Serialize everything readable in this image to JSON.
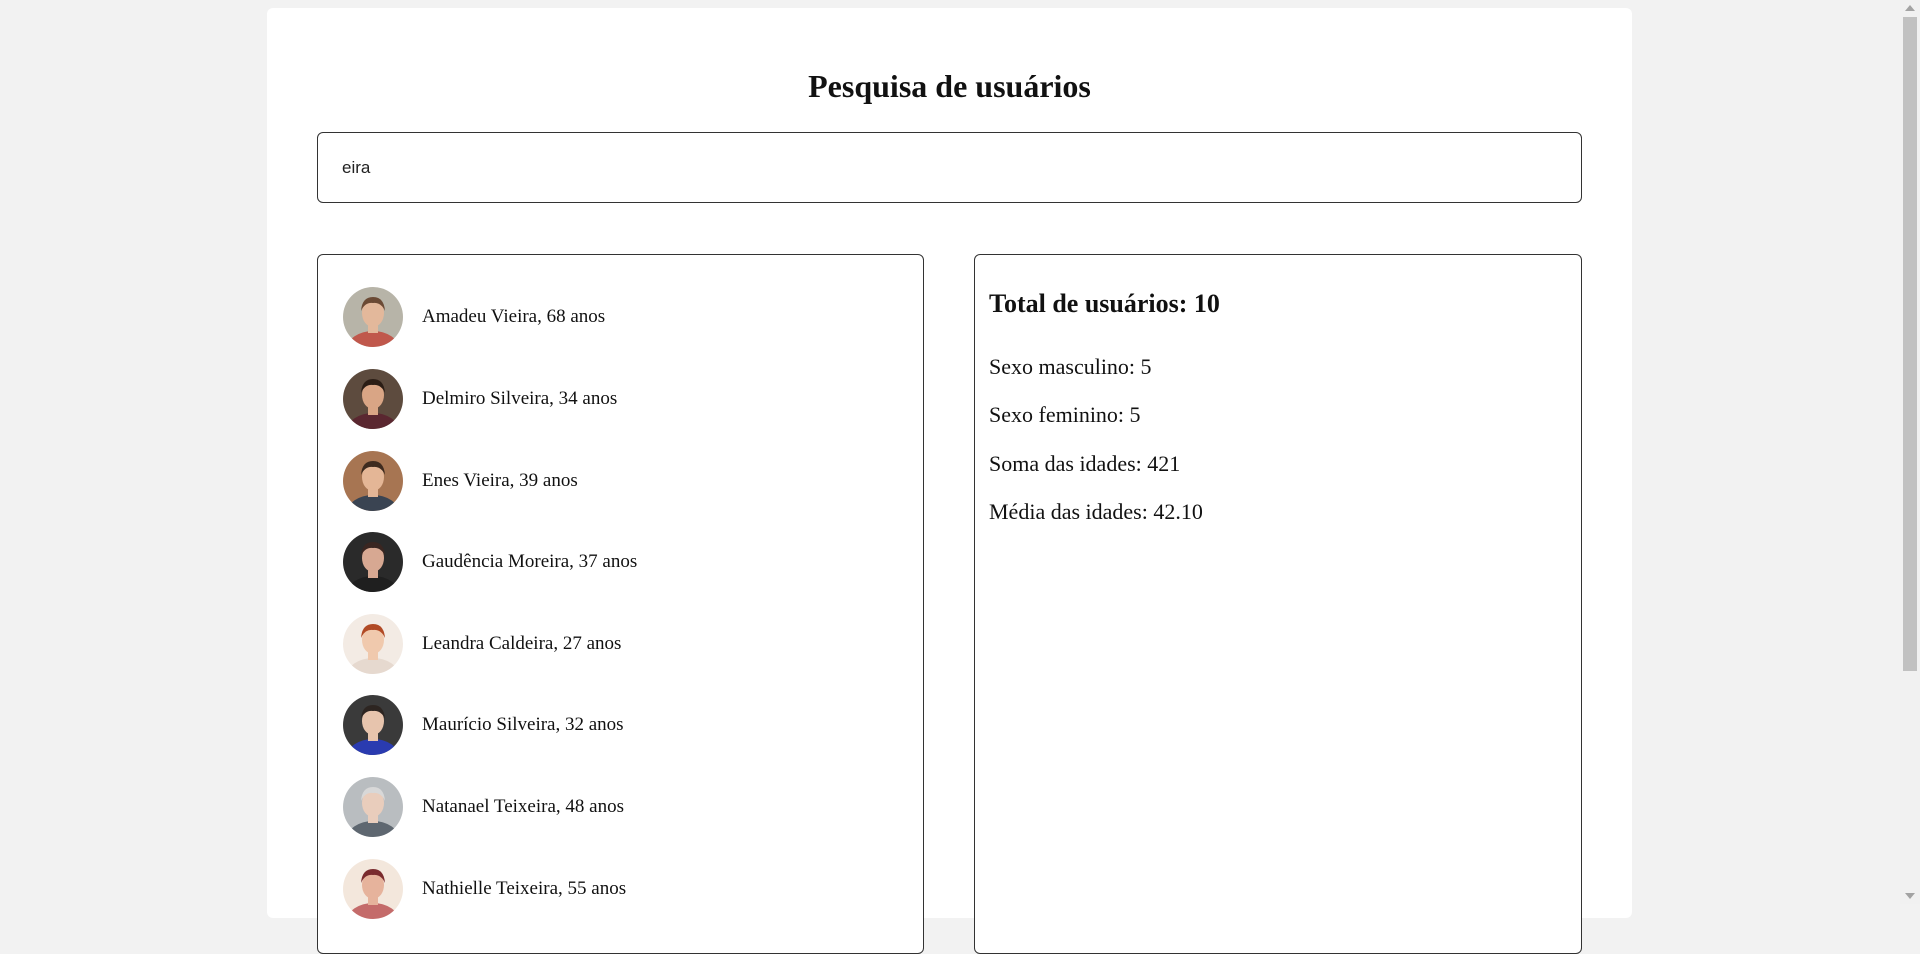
{
  "page": {
    "title": "Pesquisa de usuários"
  },
  "search": {
    "value": "eira"
  },
  "users": [
    {
      "label": "Amadeu Vieira, 68 anos",
      "avatar_bg": "#b7b4a8",
      "skin": "#e3b89b",
      "hair": "#6b4a35",
      "shirt": "#c0584c"
    },
    {
      "label": "Delmiro Silveira, 34 anos",
      "avatar_bg": "#5d4b3e",
      "skin": "#d9a585",
      "hair": "#2b1d15",
      "shirt": "#5a2730"
    },
    {
      "label": "Enes Vieira, 39 anos",
      "avatar_bg": "#a77552",
      "skin": "#e4b696",
      "hair": "#3e2b1f",
      "shirt": "#3a4452"
    },
    {
      "label": "Gaudência Moreira, 37 anos",
      "avatar_bg": "#2a2a2a",
      "skin": "#d7a892",
      "hair": "#3a2621",
      "shirt": "#1f1f1f"
    },
    {
      "label": "Leandra Caldeira, 27 anos",
      "avatar_bg": "#f3ebe4",
      "skin": "#f0c9ad",
      "hair": "#b14a25",
      "shirt": "#e6d9cf"
    },
    {
      "label": "Maurício Silveira, 32 anos",
      "avatar_bg": "#3a3a3a",
      "skin": "#e7c4ad",
      "hair": "#2d2521",
      "shirt": "#2a3bb0"
    },
    {
      "label": "Natanael Teixeira, 48 anos",
      "avatar_bg": "#b9bdc0",
      "skin": "#e9cdbc",
      "hair": "#d8d8d8",
      "shirt": "#5e6770"
    },
    {
      "label": "Nathielle Teixeira, 55 anos",
      "avatar_bg": "#f3e7dc",
      "skin": "#e6b39c",
      "hair": "#7a2b2e",
      "shirt": "#c46b6a"
    }
  ],
  "stats": {
    "total": "Total de usuários: 10",
    "male": "Sexo masculino: 5",
    "female": "Sexo feminino: 5",
    "sum_ages": "Soma das idades: 421",
    "avg_ages": "Média das idades: 42.10"
  }
}
